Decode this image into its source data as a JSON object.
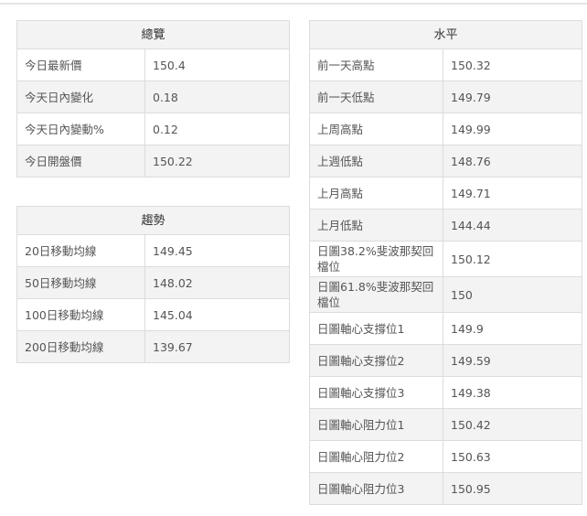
{
  "overview": {
    "title": "總覽",
    "rows": [
      {
        "label": "今日最新價",
        "value": "150.4"
      },
      {
        "label": "今天日內變化",
        "value": "0.18"
      },
      {
        "label": "今天日內變動%",
        "value": "0.12"
      },
      {
        "label": "今日開盤價",
        "value": "150.22"
      }
    ]
  },
  "trend": {
    "title": "趨勢",
    "rows": [
      {
        "label": "20日移動均線",
        "value": "149.45"
      },
      {
        "label": "50日移動均線",
        "value": "148.02"
      },
      {
        "label": "100日移動均線",
        "value": "145.04"
      },
      {
        "label": "200日移動均線",
        "value": "139.67"
      }
    ]
  },
  "levels": {
    "title": "水平",
    "rows": [
      {
        "label": "前一天高點",
        "value": "150.32"
      },
      {
        "label": "前一天低點",
        "value": "149.79"
      },
      {
        "label": "上周高點",
        "value": "149.99"
      },
      {
        "label": "上週低點",
        "value": "148.76"
      },
      {
        "label": "上月高點",
        "value": "149.71"
      },
      {
        "label": "上月低點",
        "value": "144.44"
      },
      {
        "label": "日圖38.2%斐波那契回檔位",
        "value": "150.12"
      },
      {
        "label": "日圖61.8%斐波那契回檔位",
        "value": "150"
      },
      {
        "label": "日圖軸心支撐位1",
        "value": "149.9"
      },
      {
        "label": "日圖軸心支撐位2",
        "value": "149.59"
      },
      {
        "label": "日圖軸心支撐位3",
        "value": "149.38"
      },
      {
        "label": "日圖軸心阻力位1",
        "value": "150.42"
      },
      {
        "label": "日圖軸心阻力位2",
        "value": "150.63"
      },
      {
        "label": "日圖軸心阻力位3",
        "value": "150.95"
      }
    ]
  }
}
